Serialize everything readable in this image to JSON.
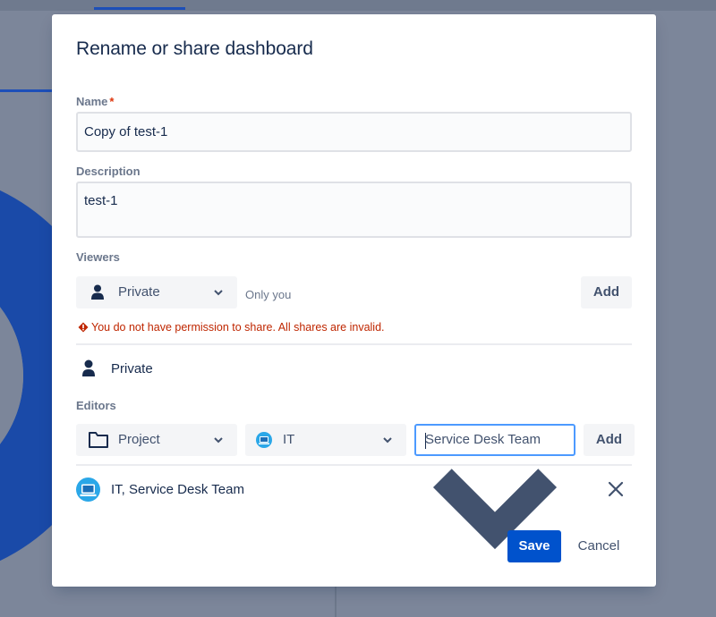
{
  "dialog": {
    "title": "Rename or share dashboard",
    "name": {
      "label": "Name",
      "required_mark": "*",
      "value": "Copy of test-1"
    },
    "description": {
      "label": "Description",
      "value": "test-1"
    },
    "viewers": {
      "label": "Viewers",
      "selected": "Private",
      "hint": "Only you",
      "add_label": "Add",
      "error": "You do not have permission to share. All shares are invalid.",
      "shares": [
        {
          "icon": "person-icon",
          "label": "Private"
        }
      ]
    },
    "editors": {
      "label": "Editors",
      "type_selected": "Project",
      "project_selected": "IT",
      "role_selected": "Service Desk Team",
      "add_label": "Add",
      "shares": [
        {
          "icon": "project-avatar-icon",
          "label": "IT, Service Desk Team"
        }
      ]
    },
    "footer": {
      "save_label": "Save",
      "cancel_label": "Cancel"
    }
  },
  "colors": {
    "primary": "#0052cc",
    "error": "#bf2600",
    "focus": "#4c9aff",
    "backdrop": "#7c869a"
  }
}
